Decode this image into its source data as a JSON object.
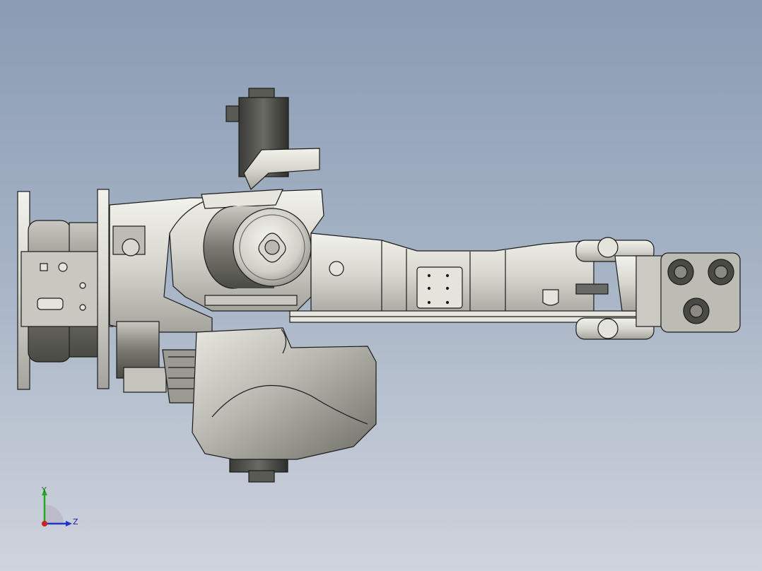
{
  "viewport": {
    "background_top": "#8a9bb3",
    "background_bottom": "#cfd3dc"
  },
  "model": {
    "icon": "robot-arm-cad-model",
    "body_color": "#d8d8d0",
    "shade_color": "#8e8e86",
    "outline_color": "#1a1a1a"
  },
  "triad": {
    "y_label": "Y",
    "z_label": "Z",
    "y_color": "#22aa22",
    "z_color": "#2233cc",
    "x_color": "#cc2222"
  }
}
